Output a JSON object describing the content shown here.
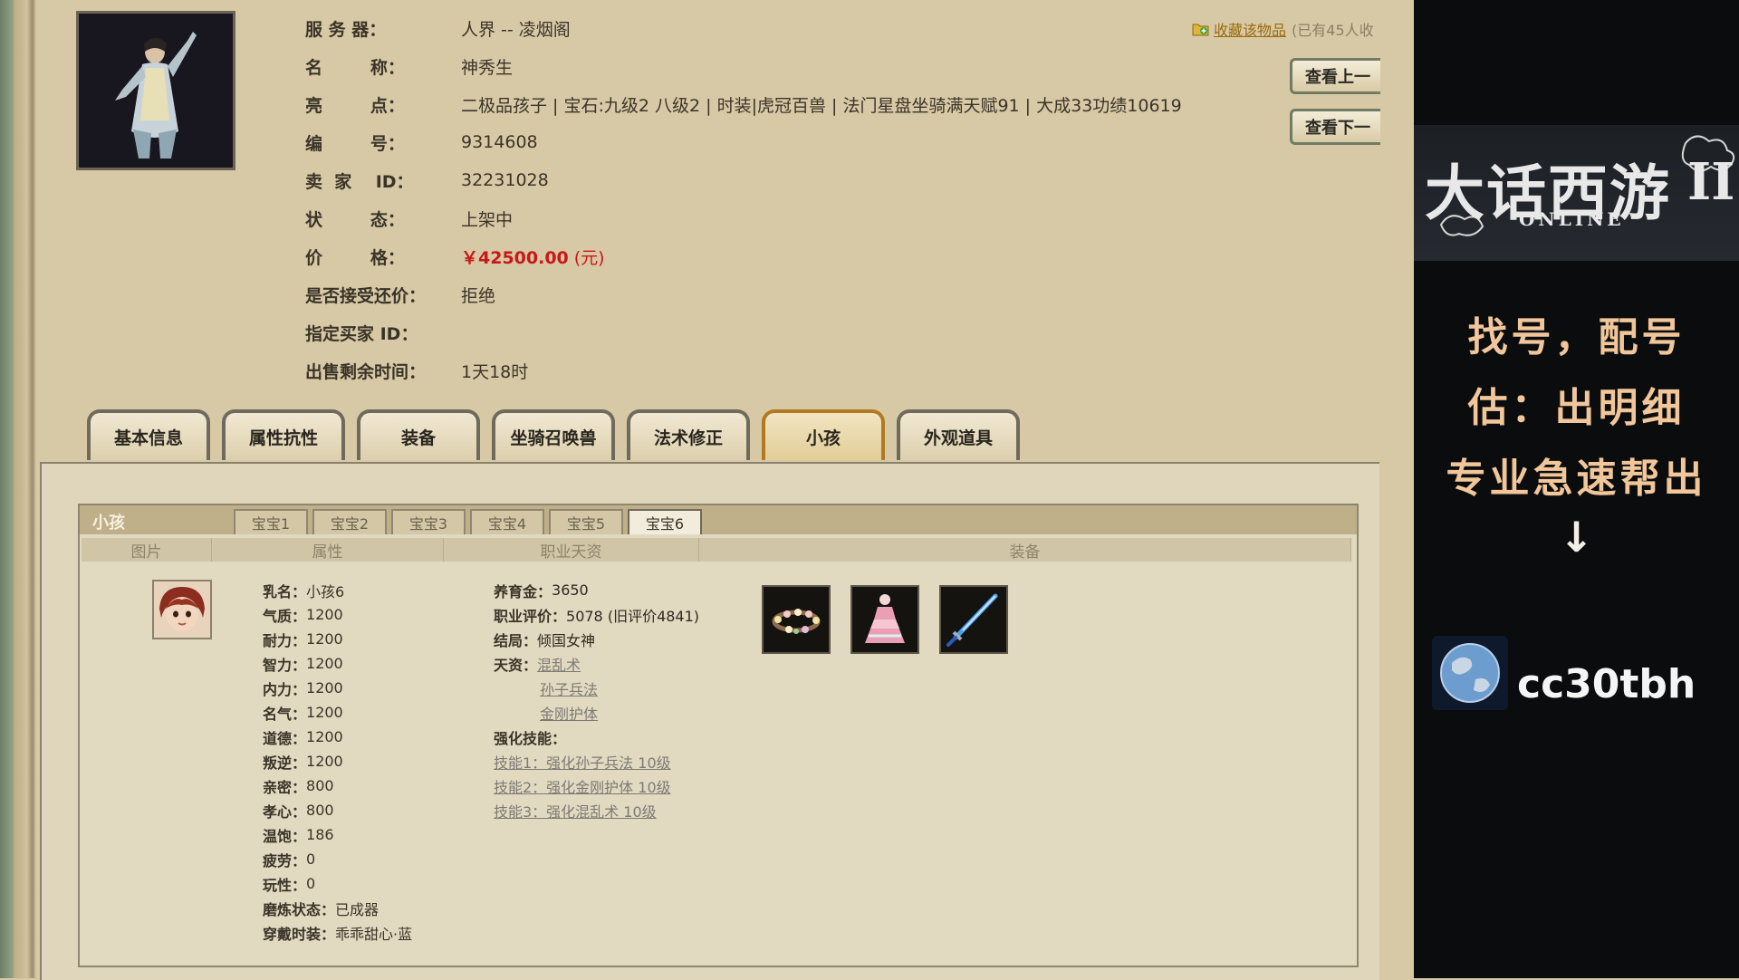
{
  "info": {
    "server_label": "服 务 器：",
    "server": "人界 -- 凌烟阁",
    "name_label": "名        称：",
    "name": "神秀生",
    "highlight_label": "亮        点：",
    "highlight": "二极品孩子 | 宝石:九级2 八级2 | 时装|虎冠百兽 | 法门星盘坐骑满天赋91 | 大成33功绩10619",
    "id_label": "编        号：",
    "id": "9314608",
    "seller_label": "卖  家    ID：",
    "seller": "32231028",
    "status_label": "状        态：",
    "status": "上架中",
    "price_label": "价        格：",
    "price": "￥42500.00",
    "price_unit": "(元)",
    "bargain_label": "是否接受还价：",
    "bargain": "拒绝",
    "buyer_label": "指定买家 ID：",
    "buyer": "",
    "remain_label": "出售剩余时间：",
    "remain": "1天18时"
  },
  "favorite": {
    "link": "收藏该物品",
    "count": "(已有45人收"
  },
  "nav": {
    "prev": "查看上一",
    "next": "查看下一"
  },
  "tabs": [
    "基本信息",
    "属性抗性",
    "装备",
    "坐骑召唤兽",
    "法术修正",
    "小孩",
    "外观道具"
  ],
  "active_tab": "小孩",
  "child_panel": {
    "title": "小孩",
    "sub_tabs": [
      "宝宝1",
      "宝宝2",
      "宝宝3",
      "宝宝4",
      "宝宝5",
      "宝宝6"
    ],
    "columns": [
      "图片",
      "属性",
      "职业天资",
      "装备"
    ],
    "attributes": [
      {
        "label": "乳名：",
        "value": "小孩6"
      },
      {
        "label": "气质：",
        "value": "1200"
      },
      {
        "label": "耐力：",
        "value": "1200"
      },
      {
        "label": "智力：",
        "value": "1200"
      },
      {
        "label": "内力：",
        "value": "1200"
      },
      {
        "label": "名气：",
        "value": "1200"
      },
      {
        "label": "道德：",
        "value": "1200"
      },
      {
        "label": "叛逆：",
        "value": "1200"
      },
      {
        "label": "亲密：",
        "value": "800"
      },
      {
        "label": "孝心：",
        "value": "800"
      },
      {
        "label": "温饱：",
        "value": "186"
      },
      {
        "label": "疲劳：",
        "value": "0"
      },
      {
        "label": "玩性：",
        "value": "0"
      },
      {
        "label": "磨炼状态：",
        "value": "已成器"
      },
      {
        "label": "穿戴时装：",
        "value": "乖乖甜心·蓝"
      }
    ],
    "talent": {
      "money_label": "养育金：",
      "money": "3650",
      "score_label": "职业评价：",
      "score": "5078 (旧评价4841)",
      "ending_label": "结局：",
      "ending": "倾国女神",
      "talents_label": "天资：",
      "talents": [
        "混乱术",
        "孙子兵法",
        "金刚护体"
      ],
      "skills_label": "强化技能：",
      "skills": [
        "技能1：强化孙子兵法 10级",
        "技能2：强化金刚护体 10级",
        "技能3：强化混乱术 10级"
      ]
    }
  },
  "promo": {
    "logo_script": "大话西游",
    "logo_numeral": "II",
    "logo_online": "ONLINE",
    "line1": "找号，配号",
    "line2": "估：出明细",
    "line3": "专业急速帮出",
    "arrow": "↓",
    "handle": "cc30tbh"
  },
  "colors": {
    "price": "#c81818",
    "active_tab_border": "#b07a22",
    "link": "#7c7a74",
    "promo_text": "#f0c69a"
  }
}
